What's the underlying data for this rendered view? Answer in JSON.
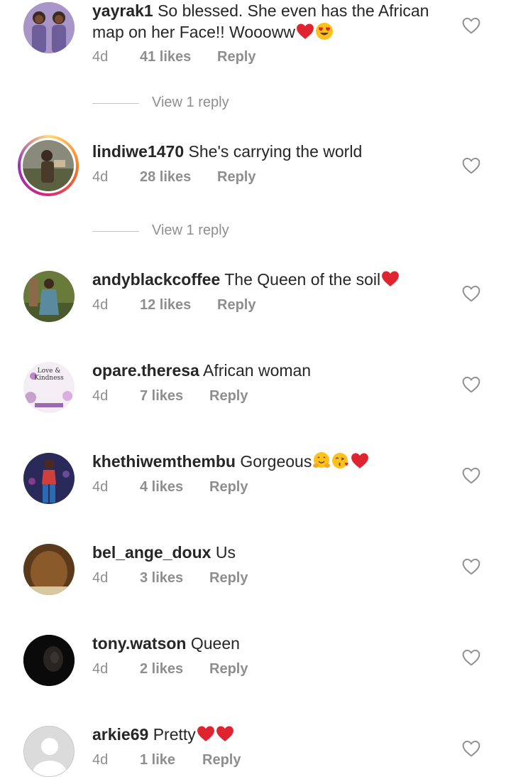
{
  "comments": [
    {
      "username": "yayrak1",
      "text": "So blessed. She even has the African map on her Face!! Woooww",
      "time": "4d",
      "likes": "41 likes",
      "reply": "Reply",
      "view_replies": "View 1 reply"
    },
    {
      "username": "lindiwe1470",
      "text": "She's carrying the world",
      "time": "4d",
      "likes": "28 likes",
      "reply": "Reply",
      "view_replies": "View 1 reply"
    },
    {
      "username": "andyblackcoffee",
      "text": "The Queen of the soil",
      "time": "4d",
      "likes": "12 likes",
      "reply": "Reply"
    },
    {
      "username": "opare.theresa",
      "text": "African woman",
      "time": "4d",
      "likes": "7 likes",
      "reply": "Reply",
      "avatar_text": "Love & Kindness"
    },
    {
      "username": "khethiwemthembu",
      "text": "Gorgeous",
      "time": "4d",
      "likes": "4 likes",
      "reply": "Reply"
    },
    {
      "username": "bel_ange_doux",
      "text": "Us",
      "time": "4d",
      "likes": "3 likes",
      "reply": "Reply"
    },
    {
      "username": "tony.watson",
      "text": "Queen",
      "time": "4d",
      "likes": "2 likes",
      "reply": "Reply"
    },
    {
      "username": "arkie69",
      "text": "Pretty",
      "time": "4d",
      "likes": "1 like",
      "reply": "Reply"
    }
  ],
  "icons": {
    "like": "heart-outline-icon",
    "emoji_heart": "red-heart-emoji",
    "emoji_heart_eyes": "heart-eyes-emoji",
    "emoji_hug": "hugging-face-emoji",
    "emoji_kiss": "face-blowing-kiss-emoji"
  },
  "colors": {
    "text": "#262626",
    "meta": "#8e8e8e",
    "heart_emoji": "#e0242f"
  }
}
